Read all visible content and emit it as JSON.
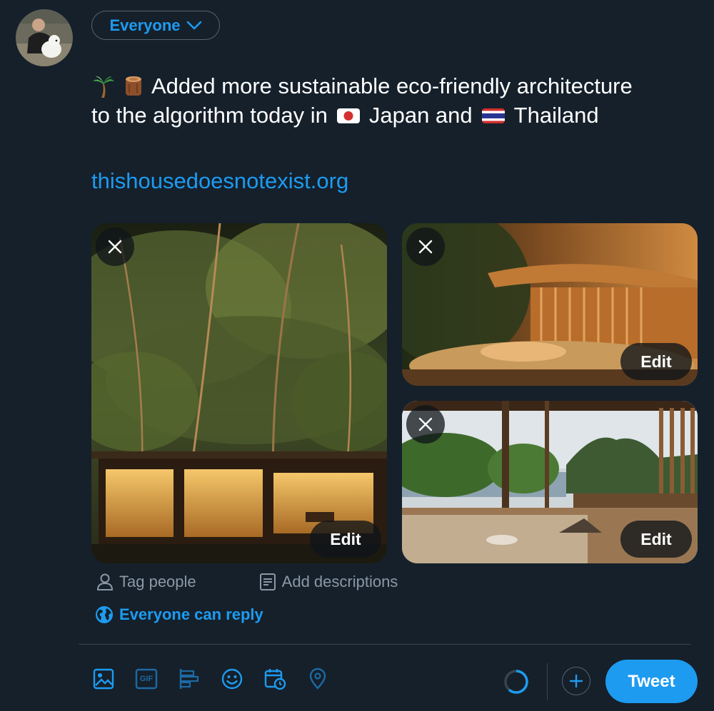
{
  "audience": {
    "label": "Everyone"
  },
  "composer": {
    "text_line1": "Added more sustainable eco-friendly architecture",
    "text_line2_a": "to the algorithm today in",
    "text_line2_b": "Japan and",
    "text_line2_c": "Thailand",
    "link": "thishousedoesnotexist.org"
  },
  "media": [
    {
      "edit_label": "Edit"
    },
    {
      "edit_label": "Edit"
    },
    {
      "edit_label": "Edit"
    }
  ],
  "actions": {
    "tag_people": "Tag people",
    "add_descriptions": "Add descriptions",
    "reply_setting": "Everyone can reply"
  },
  "toolbar": {
    "icons": [
      "image-icon",
      "gif-icon",
      "poll-icon",
      "emoji-icon",
      "schedule-icon",
      "location-icon"
    ],
    "gif_text": "GIF",
    "tweet_label": "Tweet"
  },
  "colors": {
    "background": "#15202b",
    "accent": "#1d9bf0",
    "muted": "#8b98a5",
    "border": "#38444d"
  }
}
